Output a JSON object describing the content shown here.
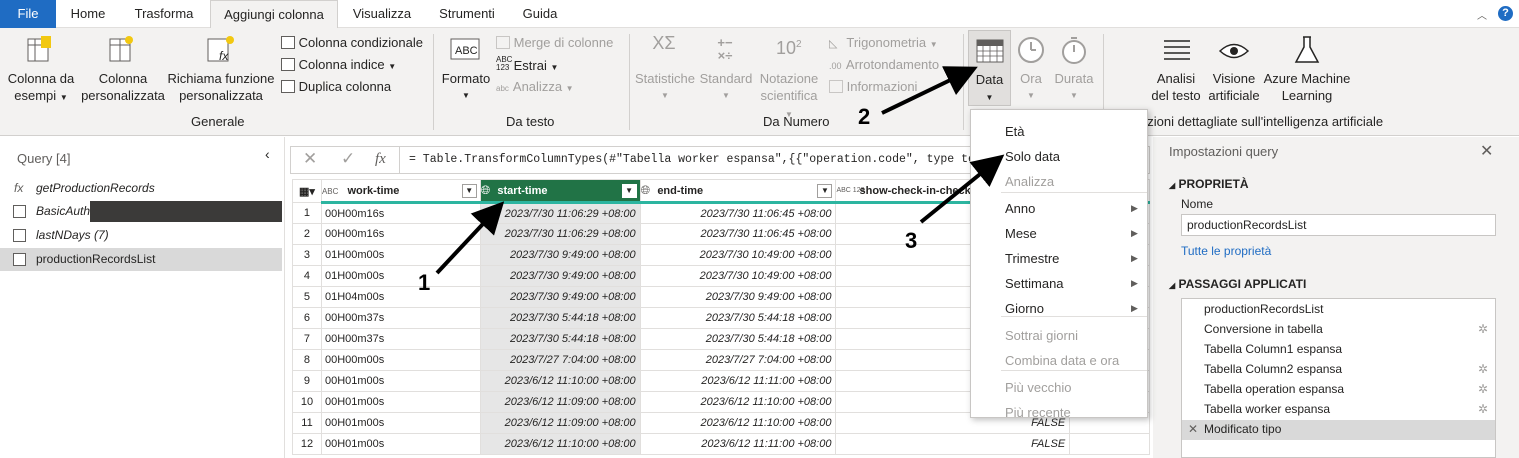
{
  "tabs": [
    "File",
    "Home",
    "Trasforma",
    "Aggiungi colonna",
    "Visualizza",
    "Strumenti",
    "Guida"
  ],
  "ribbon": {
    "colonna_da_esempi": [
      "Colonna da",
      "esempi"
    ],
    "colonna_personalizzata": [
      "Colonna",
      "personalizzata"
    ],
    "richiama_funzione": [
      "Richiama funzione",
      "personalizzata"
    ],
    "colonna_condizionale": "Colonna condizionale",
    "colonna_indice": "Colonna indice",
    "duplica_colonna": "Duplica colonna",
    "group_generale": "Generale",
    "formato": "Formato",
    "merge": "Merge di colonne",
    "estrai": "Estrai",
    "analizza": "Analizza",
    "group_testo": "Da testo",
    "statistiche": "Statistiche",
    "standard": "Standard",
    "notazione": [
      "Notazione",
      "scientifica"
    ],
    "trigonometria": "Trigonometria",
    "arrotondamento": "Arrotondamento",
    "informazioni": "Informazioni",
    "group_numero": "Da Numero",
    "data": "Data",
    "ora": "Ora",
    "durata": "Durata",
    "analisi_testo": [
      "Analisi",
      "del testo"
    ],
    "visione": [
      "Visione",
      "artificiale"
    ],
    "azure": [
      "Azure Machine",
      "Learning"
    ],
    "group_ai": "Informazioni dettagliate sull'intelligenza artificiale",
    "group_ai_visible": "azioni dettagliate sull'intelligenza artificiale"
  },
  "left": {
    "title": "Query [4]",
    "queries": [
      "getProductionRecords",
      "BasicAuth",
      "lastNDays (7)",
      "productionRecordsList"
    ]
  },
  "formula": "= Table.TransformColumnTypes(#\"Tabella worker espansa\",{{\"operation.code\", type text},",
  "grid": {
    "headers": [
      "work-time",
      "start-time",
      "end-time",
      "show-check-in-check"
    ],
    "header_types": [
      "ABC",
      "",
      "",
      "ABC 123"
    ],
    "rows": [
      [
        "1",
        "00H00m16s",
        "2023/7/30 11:06:29 +08:00",
        "2023/7/30 11:06:45 +08:00",
        ""
      ],
      [
        "2",
        "00H00m16s",
        "2023/7/30 11:06:29 +08:00",
        "2023/7/30 11:06:45 +08:00",
        ""
      ],
      [
        "3",
        "01H00m00s",
        "2023/7/30 9:49:00 +08:00",
        "2023/7/30 10:49:00 +08:00",
        ""
      ],
      [
        "4",
        "01H00m00s",
        "2023/7/30 9:49:00 +08:00",
        "2023/7/30 10:49:00 +08:00",
        ""
      ],
      [
        "5",
        "01H04m00s",
        "2023/7/30 9:49:00 +08:00",
        "2023/7/30 9:49:00 +08:00",
        ""
      ],
      [
        "6",
        "00H00m37s",
        "2023/7/30 5:44:18 +08:00",
        "2023/7/30 5:44:18 +08:00",
        ""
      ],
      [
        "7",
        "00H00m37s",
        "2023/7/30 5:44:18 +08:00",
        "2023/7/30 5:44:18 +08:00",
        ""
      ],
      [
        "8",
        "00H00m00s",
        "2023/7/27 7:04:00 +08:00",
        "2023/7/27 7:04:00 +08:00",
        ""
      ],
      [
        "9",
        "00H01m00s",
        "2023/6/12 11:10:00 +08:00",
        "2023/6/12 11:11:00 +08:00",
        ""
      ],
      [
        "10",
        "00H01m00s",
        "2023/6/12 11:09:00 +08:00",
        "2023/6/12 11:10:00 +08:00",
        ""
      ],
      [
        "11",
        "00H01m00s",
        "2023/6/12 11:09:00 +08:00",
        "2023/6/12 11:10:00 +08:00",
        "FALSE"
      ],
      [
        "12",
        "00H01m00s",
        "2023/6/12 11:10:00 +08:00",
        "2023/6/12 11:11:00 +08:00",
        "FALSE"
      ]
    ]
  },
  "menu": {
    "items": [
      "Età",
      "Solo data",
      "Analizza",
      "Anno",
      "Mese",
      "Trimestre",
      "Settimana",
      "Giorno",
      "Sottrai giorni",
      "Combina data e ora",
      "Più vecchio",
      "Più recente"
    ]
  },
  "right": {
    "title": "Impostazioni query",
    "proprieta": "PROPRIETÀ",
    "nome_label": "Nome",
    "nome_value": "productionRecordsList",
    "tutte": "Tutte le proprietà",
    "passaggi": "PASSAGGI APPLICATI",
    "steps": [
      "productionRecordsList",
      "Conversione in tabella",
      "Tabella Column1 espansa",
      "Tabella Column2 espansa",
      "Tabella operation espansa",
      "Tabella worker espansa",
      "Modificato tipo"
    ]
  },
  "annotations": [
    "1",
    "2",
    "3"
  ],
  "colors": {
    "file_tab": "#1f6cc3",
    "start_header": "#217346",
    "accent_bar": "#2cb5a0",
    "selected_step": "#d9d9d9"
  }
}
